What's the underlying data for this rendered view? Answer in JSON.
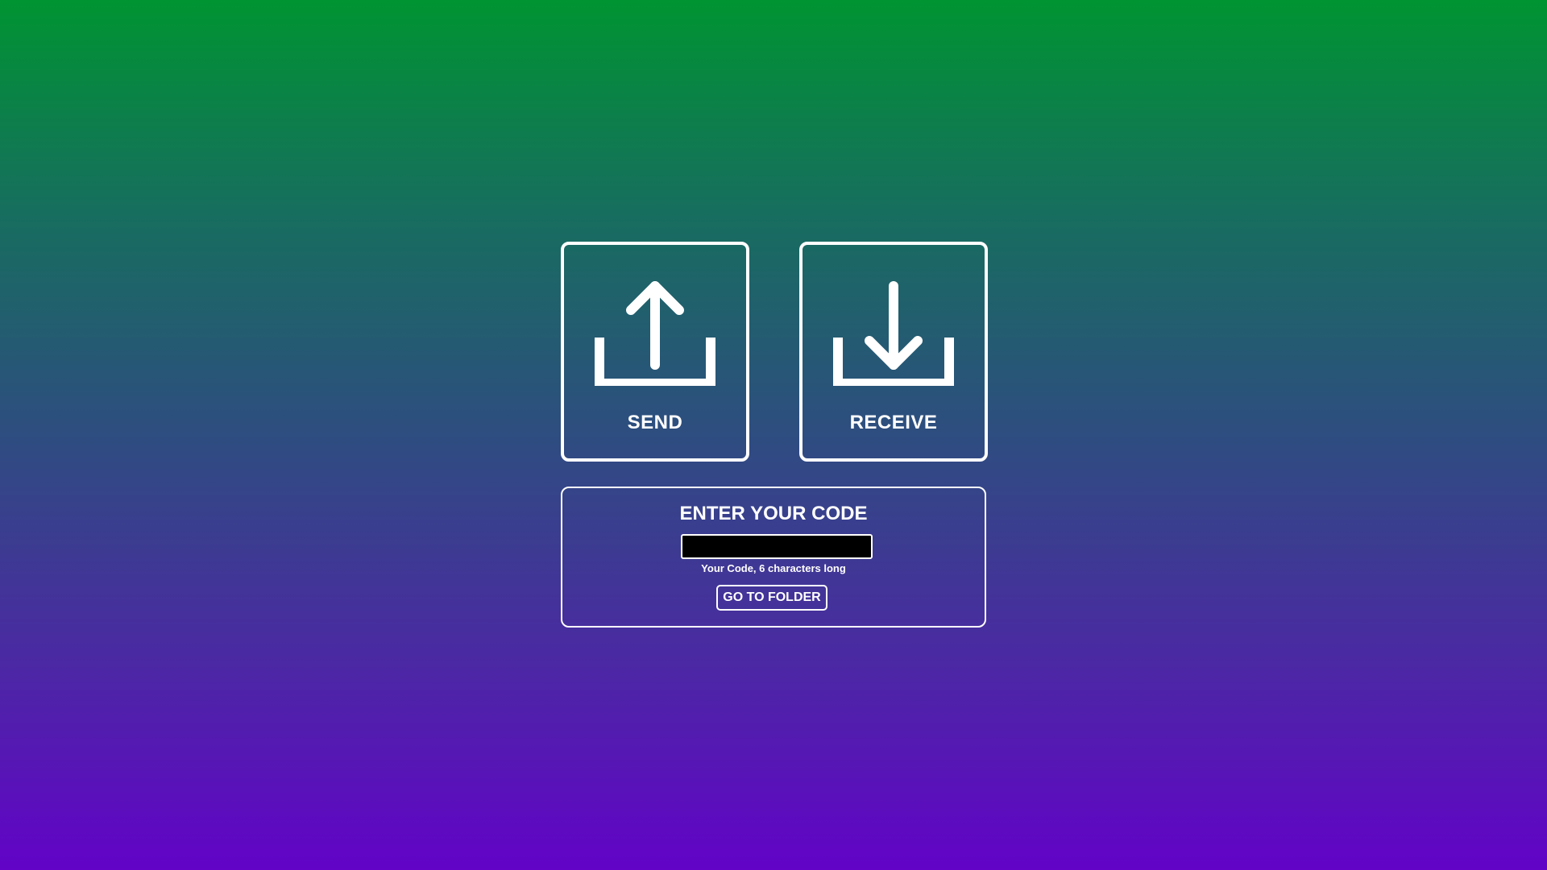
{
  "tiles": {
    "send": {
      "label": "SEND",
      "icon": "upload-icon"
    },
    "receive": {
      "label": "RECEIVE",
      "icon": "download-icon"
    }
  },
  "code_panel": {
    "title": "ENTER YOUR CODE",
    "input_value": "",
    "help_text": "Your Code, 6 characters long",
    "button_label": "GO TO FOLDER"
  },
  "colors": {
    "gradient_top": "#009432",
    "gradient_bottom": "#6203c7",
    "foreground": "#ffffff",
    "input_background": "#000000"
  }
}
